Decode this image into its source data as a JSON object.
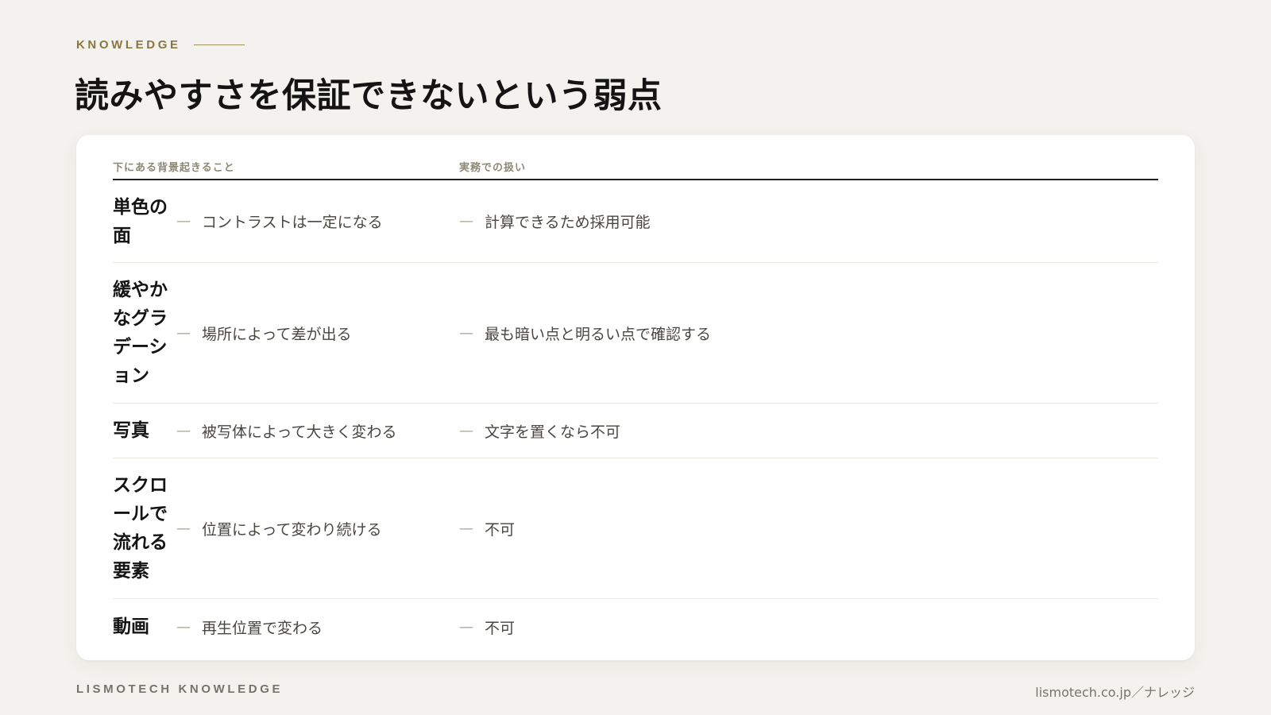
{
  "theme": {
    "accent": "#8a7740",
    "background": "#f4f2ee",
    "card": "#ffffff",
    "text_primary": "#141414",
    "text_secondary": "#4a4742",
    "muted": "#8e8775"
  },
  "header": {
    "eyebrow": "KNOWLEDGE",
    "title": "読みやすさを保証できないという弱点"
  },
  "table": {
    "columns": {
      "background": "下にある背景起きること",
      "practice": "実務での扱い"
    },
    "dash": "—",
    "rows": [
      {
        "label": "単色の面",
        "background": "コントラストは一定になる",
        "practice": "計算できるため採用可能"
      },
      {
        "label": "緩やかなグラデーション",
        "background": "場所によって差が出る",
        "practice": "最も暗い点と明るい点で確認する"
      },
      {
        "label": "写真",
        "background": "被写体によって大きく変わる",
        "practice": "文字を置くなら不可"
      },
      {
        "label": "スクロールで流れる要素",
        "background": "位置によって変わり続ける",
        "practice": "不可"
      },
      {
        "label": "動画",
        "background": "再生位置で変わる",
        "practice": "不可"
      }
    ]
  },
  "footer": {
    "brand": "LISMOTECH KNOWLEDGE",
    "url": "lismotech.co.jp／ナレッジ"
  }
}
